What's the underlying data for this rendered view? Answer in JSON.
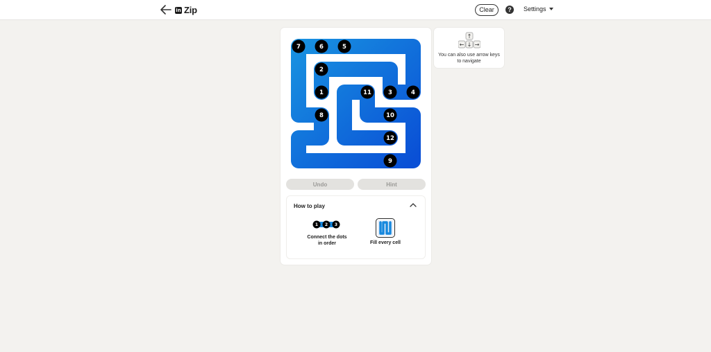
{
  "header": {
    "title": "Zip",
    "brand_badge": "in",
    "clear_label": "Clear",
    "help_label": "?",
    "settings_label": "Settings"
  },
  "board": {
    "size": "6x6",
    "dots": [
      {
        "n": "1",
        "row": 3,
        "col": 2
      },
      {
        "n": "2",
        "row": 2,
        "col": 2
      },
      {
        "n": "3",
        "row": 3,
        "col": 5
      },
      {
        "n": "4",
        "row": 3,
        "col": 6
      },
      {
        "n": "5",
        "row": 1,
        "col": 3
      },
      {
        "n": "6",
        "row": 1,
        "col": 2
      },
      {
        "n": "7",
        "row": 1,
        "col": 1
      },
      {
        "n": "8",
        "row": 4,
        "col": 2
      },
      {
        "n": "9",
        "row": 6,
        "col": 5
      },
      {
        "n": "10",
        "row": 4,
        "col": 5
      },
      {
        "n": "11",
        "row": 3,
        "col": 4
      },
      {
        "n": "12",
        "row": 5,
        "col": 5
      }
    ],
    "colors": {
      "path_light": "#1788de",
      "path_dark": "#0a58d6",
      "dot": "#000000"
    }
  },
  "controls": {
    "undo_label": "Undo",
    "hint_label": "Hint"
  },
  "how_to_play": {
    "title": "How to play",
    "step1_text": "Connect the dots in order",
    "step1_dots": [
      "1",
      "2",
      "3"
    ],
    "step2_text": "Fill every cell"
  },
  "tip": {
    "text": "You can also use arrow keys to navigate",
    "keys": [
      "↑",
      "←",
      "↓",
      "→"
    ]
  }
}
